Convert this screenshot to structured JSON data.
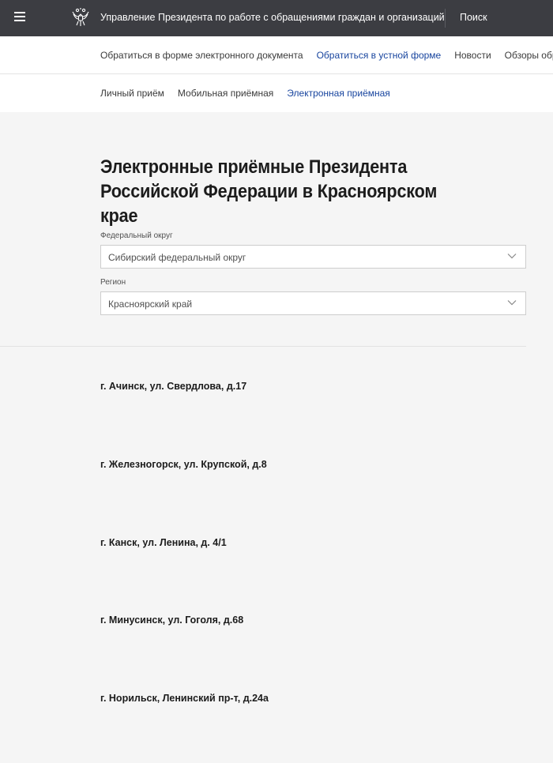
{
  "header": {
    "org_title": "Управление Президента по работе с обращениями граждан и организаций",
    "search_label": "Поиск"
  },
  "nav_primary": [
    {
      "label": "Обратиться в форме электронного документа",
      "active": false
    },
    {
      "label": "Обратиться в устной форме",
      "active": true
    },
    {
      "label": "Новости",
      "active": false
    },
    {
      "label": "Обзоры обращений",
      "active": false
    }
  ],
  "nav_secondary": [
    {
      "label": "Личный приём",
      "active": false
    },
    {
      "label": "Мобильная приёмная",
      "active": false
    },
    {
      "label": "Электронная приёмная",
      "active": true
    }
  ],
  "main": {
    "title": "Электронные приёмные Президента Российской Федерации в Красноярском крае",
    "district_label": "Федеральный округ",
    "district_value": "Сибирский федеральный округ",
    "region_label": "Регион",
    "region_value": "Красноярский край"
  },
  "addresses": [
    "г. Ачинск, ул. Свердлова, д.17",
    "г. Железногорск, ул. Крупской, д.8",
    "г. Канск, ул. Ленина, д. 4/1",
    "г. Минусинск, ул. Гоголя, д.68",
    "г. Норильск, Ленинский пр-т, д.24а"
  ],
  "colors": {
    "topbar": "#3c3d42",
    "active_link": "#17449e",
    "page_bg": "#f5f5f5"
  },
  "icons": {
    "menu": "hamburger-menu-icon",
    "emblem": "double-headed-eagle-emblem",
    "dropdown": "chevron-down-icon"
  }
}
